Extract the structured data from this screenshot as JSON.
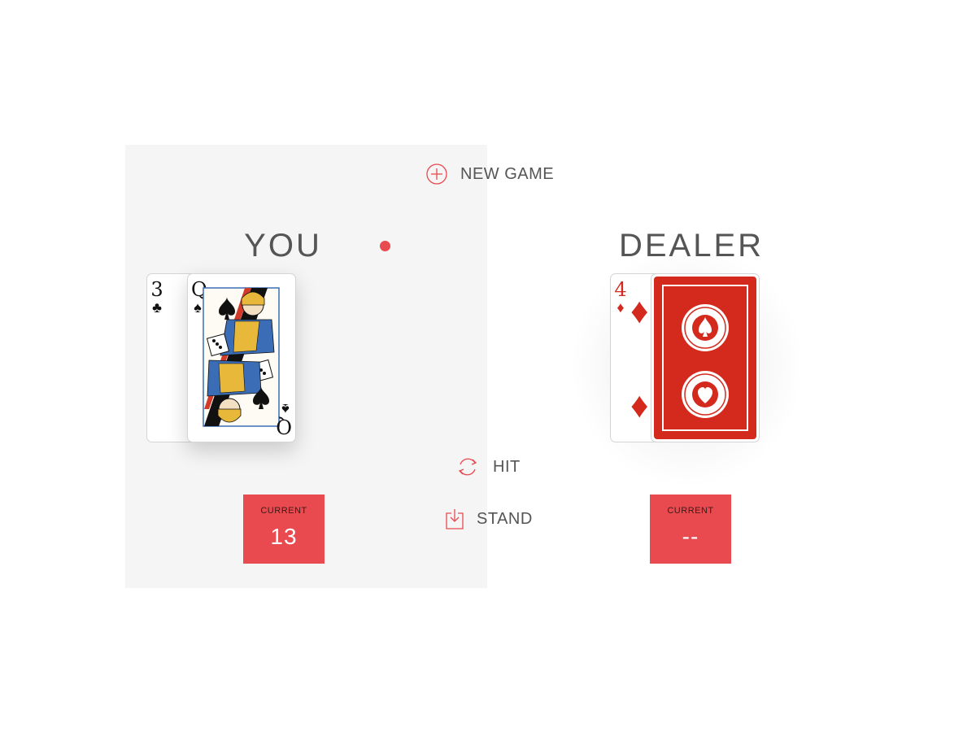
{
  "controls": {
    "new_game_label": "NEW GAME",
    "hit_label": "HIT",
    "stand_label": "STAND",
    "new_game_icon": "plus-circle-icon",
    "hit_icon": "refresh-icon",
    "stand_icon": "download-tray-icon"
  },
  "player": {
    "title": "YOU",
    "is_turn": true,
    "cards": [
      {
        "rank": "3",
        "suit": "♣",
        "color": "black",
        "face_up": true
      },
      {
        "rank": "Q",
        "suit": "♠",
        "color": "black",
        "face_up": true
      }
    ],
    "score_caption": "CURRENT",
    "score_value": "13"
  },
  "dealer": {
    "title": "DEALER",
    "cards": [
      {
        "rank": "4",
        "suit": "♦",
        "color": "red",
        "face_up": true
      },
      {
        "face_up": false
      }
    ],
    "score_caption": "CURRENT",
    "score_value": "--"
  },
  "colors": {
    "accent": "#e84a4f",
    "card_back": "#d42a1e",
    "panel": "#f5f5f5"
  }
}
